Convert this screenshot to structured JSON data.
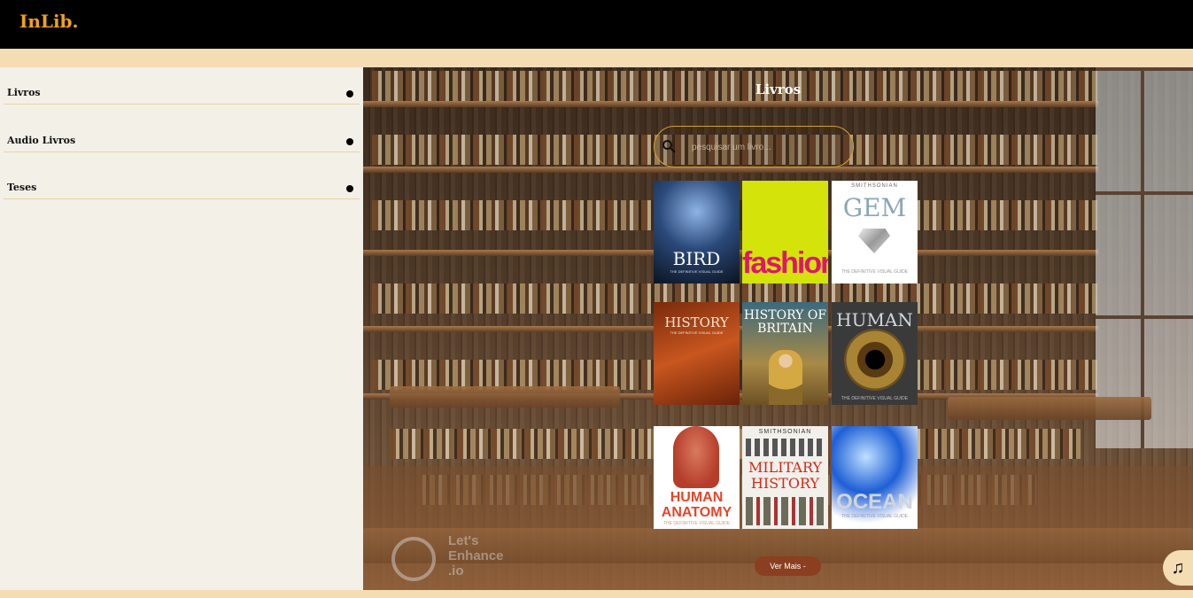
{
  "header": {
    "logo": "InLib."
  },
  "sidebar": {
    "items": [
      {
        "label": "Livros"
      },
      {
        "label": "Audio Livros"
      },
      {
        "label": "Teses"
      }
    ]
  },
  "main": {
    "title": "Livros",
    "search": {
      "placeholder": "pesquisar um livro..."
    },
    "books": [
      {
        "title": "BIRD",
        "subtitle": "THE DEFINITIVE VISUAL GUIDE"
      },
      {
        "title": "fashion",
        "subtitle": ""
      },
      {
        "title": "GEM",
        "subtitle": "THE DEFINITIVE VISUAL GUIDE",
        "publisher": "SMITHSONIAN"
      },
      {
        "title": "HISTORY",
        "subtitle": "THE DEFINITIVE VISUAL GUIDE"
      },
      {
        "title": "HISTORY OF BRITAIN",
        "subtitle": ""
      },
      {
        "title": "HUMAN",
        "subtitle": "THE DEFINITIVE VISUAL GUIDE"
      },
      {
        "title": "HUMAN ANATOMY",
        "subtitle": "THE DEFINITIVE VISUAL GUIDE"
      },
      {
        "title": "MILITARY HISTORY",
        "subtitle": "",
        "publisher": "SMITHSONIAN"
      },
      {
        "title": "OCEAN",
        "subtitle": "THE DEFINITIVE VISUAL GUIDE"
      }
    ],
    "more_button": "Ver Mais -"
  },
  "watermark": {
    "line1": "Let's",
    "line2": "Enhance",
    "line3": ".io"
  },
  "icons": {
    "search": "search-icon",
    "music": "music-note-icon",
    "bullet": "dot-icon"
  },
  "colors": {
    "accent": "#f0a21c",
    "search_border": "#d7a02d",
    "button": "#8b3f20",
    "sidebar_bg": "#f3f0e8",
    "page_bg": "#f4dcb3"
  }
}
